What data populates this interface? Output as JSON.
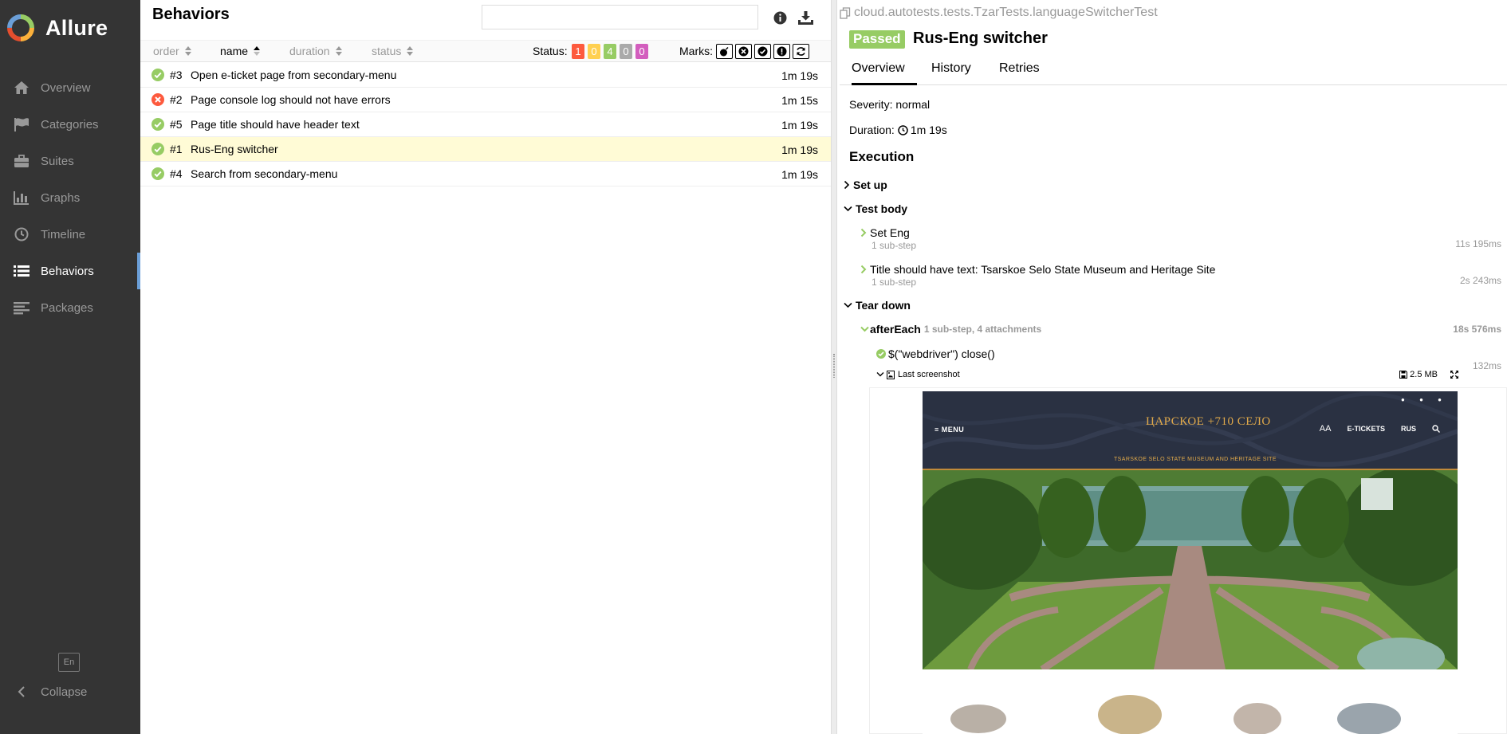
{
  "app": {
    "name": "Allure",
    "brand_colors": [
      "#e54e2e",
      "#fbb03b",
      "#97cc64",
      "#6b9fd8"
    ]
  },
  "sidebar": {
    "items": [
      {
        "label": "Overview",
        "icon": "home-icon"
      },
      {
        "label": "Categories",
        "icon": "flag-icon"
      },
      {
        "label": "Suites",
        "icon": "briefcase-icon"
      },
      {
        "label": "Graphs",
        "icon": "bar-chart-icon"
      },
      {
        "label": "Timeline",
        "icon": "clock-icon"
      },
      {
        "label": "Behaviors",
        "icon": "list-icon",
        "active": true
      },
      {
        "label": "Packages",
        "icon": "align-left-icon"
      }
    ],
    "language": "En",
    "collapse_label": "Collapse"
  },
  "behaviors": {
    "title": "Behaviors",
    "search": {
      "value": "",
      "placeholder": ""
    },
    "columns": {
      "order": "order",
      "name": "name",
      "duration": "duration",
      "status": "status"
    },
    "status_label": "Status:",
    "status_counts": [
      {
        "count": "1",
        "color": "#fd5a3e"
      },
      {
        "count": "0",
        "color": "#ffd050"
      },
      {
        "count": "4",
        "color": "#97cc64"
      },
      {
        "count": "0",
        "color": "#aaaaaa"
      },
      {
        "count": "0",
        "color": "#d35ebe"
      }
    ],
    "marks_label": "Marks:",
    "rows": [
      {
        "status": "passed",
        "order": "#3",
        "name": "Open e-ticket page from secondary-menu",
        "duration": "1m 19s"
      },
      {
        "status": "failed",
        "order": "#2",
        "name": "Page console log should not have errors",
        "duration": "1m 15s"
      },
      {
        "status": "passed",
        "order": "#5",
        "name": "Page title should have header text",
        "duration": "1m 19s"
      },
      {
        "status": "passed",
        "order": "#1",
        "name": "Rus-Eng switcher",
        "duration": "1m 19s",
        "selected": true
      },
      {
        "status": "passed",
        "order": "#4",
        "name": "Search from secondary-menu",
        "duration": "1m 19s"
      }
    ]
  },
  "test": {
    "path": "cloud.autotests.tests.TzarTests.languageSwitcherTest",
    "status": "Passed",
    "title": "Rus-Eng switcher",
    "tabs": [
      "Overview",
      "History",
      "Retries"
    ],
    "severity": "Severity: normal",
    "duration_label": "Duration:",
    "duration": "1m 19s",
    "execution_title": "Execution",
    "setup_label": "Set up",
    "body_label": "Test body",
    "steps": [
      {
        "name": "Set Eng",
        "sub": "1 sub-step",
        "time": "11s 195ms"
      },
      {
        "name": "Title should have text: Tsarskoe Selo State Museum and Heritage Site",
        "sub": "1 sub-step",
        "time": "2s 243ms"
      }
    ],
    "teardown_label": "Tear down",
    "after_each": {
      "name": "afterEach",
      "meta": "1 sub-step, 4 attachments",
      "time": "18s 576ms"
    },
    "substep": {
      "name": "$(\"webdriver\") close()",
      "time": "132ms"
    },
    "attachment": {
      "name": "Last screenshot",
      "size": "2.5 MB"
    }
  },
  "screenshot": {
    "menu": "≡ MENU",
    "logo": "ЦАРСКОЕ +710 СЕЛО",
    "tagline": "TSARSKOE SELO STATE MUSEUM AND HERITAGE SITE",
    "font_toggle": "AA",
    "tickets": "E-TICKETS",
    "lang": "RUS"
  }
}
